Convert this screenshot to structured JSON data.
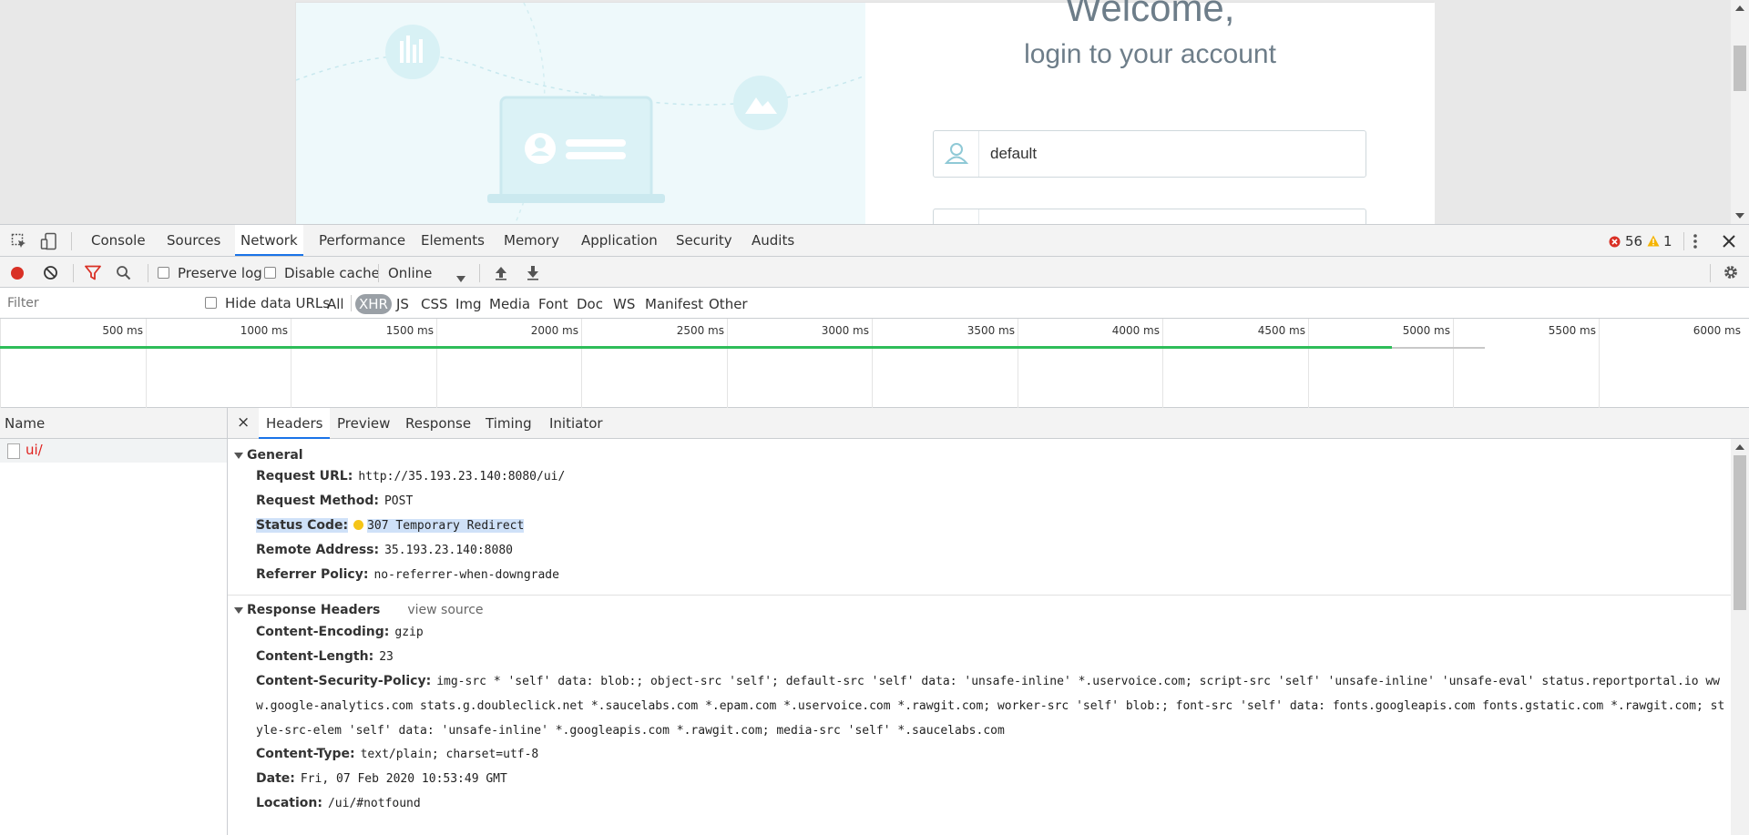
{
  "page": {
    "welcome": "Welcome,",
    "subtitle": "login to your account",
    "login_value": "default"
  },
  "devtools": {
    "tabs": [
      "Console",
      "Sources",
      "Network",
      "Performance",
      "Elements",
      "Memory",
      "Application",
      "Security",
      "Audits"
    ],
    "active_tab": "Network",
    "errors_count": "56",
    "warnings_count": "1",
    "toolbar": {
      "preserve_log": "Preserve log",
      "disable_cache": "Disable cache",
      "throttle": "Online"
    },
    "filter": {
      "placeholder": "Filter",
      "hide_data_urls": "Hide data URLs",
      "types": [
        "All",
        "XHR",
        "JS",
        "CSS",
        "Img",
        "Media",
        "Font",
        "Doc",
        "WS",
        "Manifest",
        "Other"
      ],
      "active_type": "XHR"
    },
    "timeline": {
      "ticks": [
        "500 ms",
        "1000 ms",
        "1500 ms",
        "2000 ms",
        "2500 ms",
        "3000 ms",
        "3500 ms",
        "4000 ms",
        "4500 ms",
        "5000 ms",
        "5500 ms",
        "6000 ms"
      ]
    },
    "requests": {
      "column_name": "Name",
      "items": [
        "ui/"
      ]
    },
    "details": {
      "close": "×",
      "tabs": [
        "Headers",
        "Preview",
        "Response",
        "Timing",
        "Initiator"
      ],
      "active_tab": "Headers",
      "general": {
        "title": "General",
        "rows": [
          {
            "k": "Request URL:",
            "v": "http://35.193.23.140:8080/ui/"
          },
          {
            "k": "Request Method:",
            "v": "POST"
          },
          {
            "k": "Status Code:",
            "v": "307 Temporary Redirect"
          },
          {
            "k": "Remote Address:",
            "v": "35.193.23.140:8080"
          },
          {
            "k": "Referrer Policy:",
            "v": "no-referrer-when-downgrade"
          }
        ]
      },
      "response_headers": {
        "title": "Response Headers",
        "view_source": "view source",
        "rows": [
          {
            "k": "Content-Encoding:",
            "v": "gzip"
          },
          {
            "k": "Content-Length:",
            "v": "23"
          },
          {
            "k": "Content-Security-Policy:",
            "v": "img-src * 'self' data: blob:; object-src 'self'; default-src 'self' data: 'unsafe-inline' *.uservoice.com; script-src 'self' 'unsafe-inline' 'unsafe-eval' status.reportportal.io www.google-analytics.com stats.g.doubleclick.net *.saucelabs.com *.epam.com *.uservoice.com *.rawgit.com; worker-src 'self' blob:; font-src 'self' data: fonts.googleapis.com fonts.gstatic.com *.rawgit.com; style-src-elem 'self' data: 'unsafe-inline' *.googleapis.com *.rawgit.com; media-src 'self' *.saucelabs.com"
          },
          {
            "k": "Content-Type:",
            "v": "text/plain; charset=utf-8"
          },
          {
            "k": "Date:",
            "v": "Fri, 07 Feb 2020 10:53:49 GMT"
          },
          {
            "k": "Location:",
            "v": "/ui/#notfound"
          }
        ]
      }
    }
  },
  "colors": {
    "accent": "#1a73e8",
    "record_red": "#d93025",
    "status_dot": "#f5c518",
    "timeline_green": "#2ebd59",
    "request_name_red": "#e0201d"
  }
}
